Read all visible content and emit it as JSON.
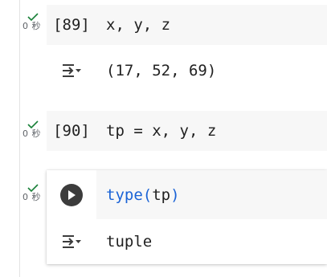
{
  "cells": [
    {
      "status_time": "0 秒",
      "exec_count": "[89]",
      "code": "x, y, z",
      "output": "(17, 52, 69)"
    },
    {
      "status_time": "0 秒",
      "exec_count": "[90]",
      "code": "tp = x, y, z"
    },
    {
      "status_time": "0 秒",
      "code_func": "type",
      "code_open": "(",
      "code_arg": "tp",
      "code_close": ")",
      "output": "tuple"
    }
  ],
  "icons": {
    "status": "check-icon",
    "output": "output-toggle-icon",
    "run": "play-icon"
  },
  "colors": {
    "check": "#188038",
    "builtin": "#1a63d6",
    "cell_background": "#f7f7f7",
    "run_button": "#3c3c3c"
  }
}
